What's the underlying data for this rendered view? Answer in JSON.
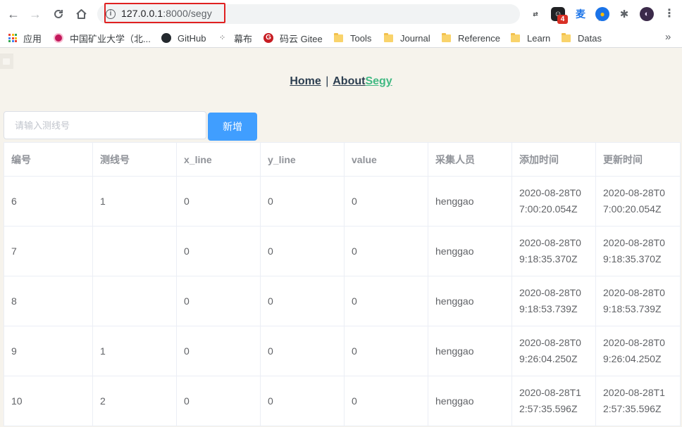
{
  "browser": {
    "url_host": "127.0.0.1",
    "url_rest": ":8000/segy",
    "bookmarks": [
      {
        "label": "应用",
        "icon": "apps-icon"
      },
      {
        "label": "中国矿业大学（北...",
        "icon": "university-icon"
      },
      {
        "label": "GitHub",
        "icon": "github-icon"
      },
      {
        "label": "幕布",
        "icon": "mubu-icon"
      },
      {
        "label": "码云 Gitee",
        "icon": "gitee-icon"
      },
      {
        "label": "Tools",
        "icon": "folder-icon"
      },
      {
        "label": "Journal",
        "icon": "folder-icon"
      },
      {
        "label": "Reference",
        "icon": "folder-icon"
      },
      {
        "label": "Learn",
        "icon": "folder-icon"
      },
      {
        "label": "Datas",
        "icon": "folder-icon"
      }
    ],
    "extension_badge": "4"
  },
  "nav": {
    "home": "Home",
    "separator": "|",
    "about": "About",
    "current": "Segy"
  },
  "form": {
    "placeholder": "请输入测线号",
    "add_label": "新增"
  },
  "table": {
    "headers": [
      "编号",
      "测线号",
      "x_line",
      "y_line",
      "value",
      "采集人员",
      "添加时间",
      "更新时间"
    ],
    "rows": [
      [
        "6",
        "1",
        "0",
        "0",
        "0",
        "henggao",
        "2020-08-28T07:00:20.054Z",
        "2020-08-28T07:00:20.054Z"
      ],
      [
        "7",
        "",
        "0",
        "0",
        "0",
        "henggao",
        "2020-08-28T09:18:35.370Z",
        "2020-08-28T09:18:35.370Z"
      ],
      [
        "8",
        "",
        "0",
        "0",
        "0",
        "henggao",
        "2020-08-28T09:18:53.739Z",
        "2020-08-28T09:18:53.739Z"
      ],
      [
        "9",
        "1",
        "0",
        "0",
        "0",
        "henggao",
        "2020-08-28T09:26:04.250Z",
        "2020-08-28T09:26:04.250Z"
      ],
      [
        "10",
        "2",
        "0",
        "0",
        "0",
        "henggao",
        "2020-08-28T12:57:35.596Z",
        "2020-08-28T12:57:35.596Z"
      ]
    ]
  },
  "colors": {
    "primary": "#409eff",
    "accent": "#42b983",
    "page_bg": "#f6f3ec",
    "highlight": "#e02020"
  }
}
